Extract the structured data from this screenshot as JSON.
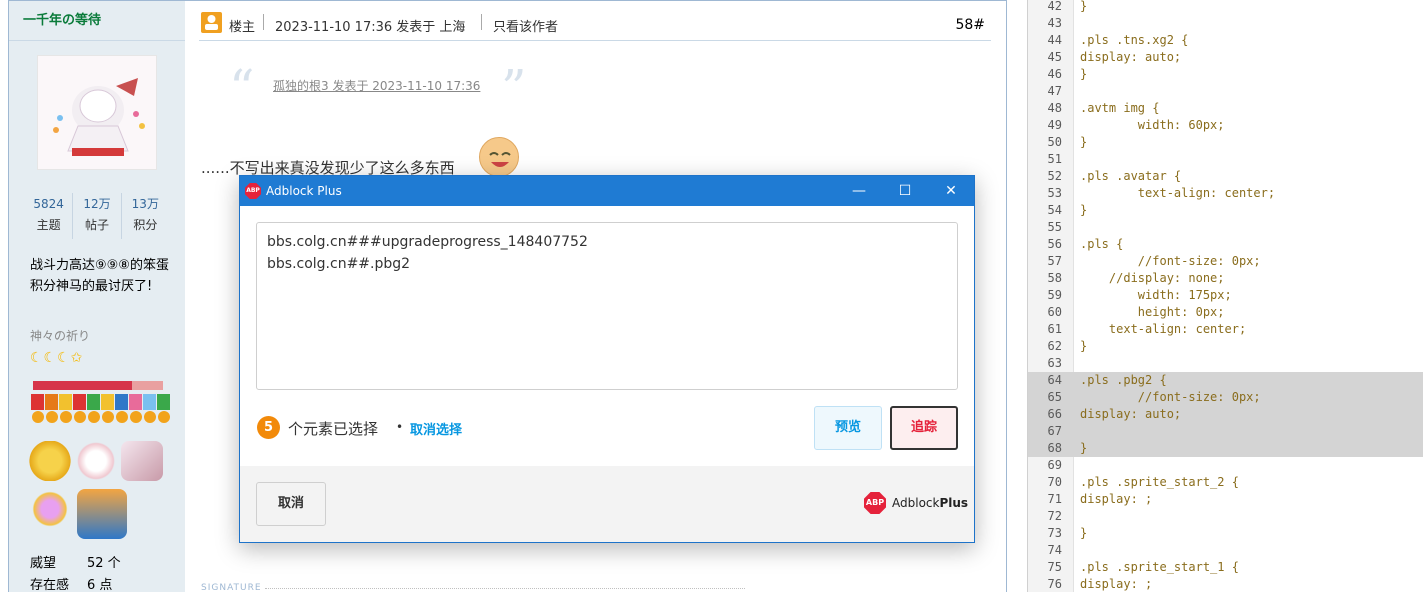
{
  "user": {
    "name": "一千年の等待",
    "stats": [
      {
        "value": "5824",
        "label": "主题"
      },
      {
        "value": "12万",
        "label": "帖子"
      },
      {
        "value": "13万",
        "label": "积分"
      }
    ],
    "title": "战斗力高达⑨⑨⑧的笨蛋积分神马的最讨厌了!",
    "group": "神々の祈り",
    "stars": "☾☾☾✩",
    "rank_progress": 0.76,
    "credits": [
      {
        "label": "威望",
        "value": "52 个"
      },
      {
        "label": "存在感",
        "value": "6 点"
      }
    ]
  },
  "post": {
    "owner_label": "楼主",
    "datetime": "2023-11-10 17:36 发表于 上海",
    "only_author": "只看该作者",
    "floor": "58#",
    "quote": "孤独的根3 发表于 2023-11-10 17:36",
    "content": "......不写出来真没发现少了这么多东西",
    "signature": "SIGNATURE"
  },
  "colors": {
    "titlebar": "#1f7bd3",
    "abp_red": "#e5223b",
    "accent_blue": "#0797e1",
    "badge_orange": "#f28a0a",
    "code_text": "#8a6d1d"
  },
  "dialog": {
    "title": "Adblock Plus",
    "logo_text": "ABP",
    "filters": [
      "bbs.colg.cn###upgradeprogress_148407752",
      "bbs.colg.cn##.pbg2"
    ],
    "selected_count": "5",
    "selected_text": "个元素已选择",
    "dot": "•",
    "deselect_label": "取消选择",
    "preview_label": "预览",
    "block_label": "追踪",
    "cancel_label": "取消",
    "brand_prefix": "Adblock",
    "brand_suffix": "Plus",
    "minimize_icon": "—",
    "maximize_icon": "☐",
    "close_icon": "✕"
  },
  "code": {
    "lines": [
      {
        "n": "42",
        "t": "}"
      },
      {
        "n": "43",
        "t": ""
      },
      {
        "n": "44",
        "t": ".pls .tns.xg2 {"
      },
      {
        "n": "45",
        "t": "display: auto;"
      },
      {
        "n": "46",
        "t": "}"
      },
      {
        "n": "47",
        "t": ""
      },
      {
        "n": "48",
        "t": ".avtm img {"
      },
      {
        "n": "49",
        "t": "        width: 60px;"
      },
      {
        "n": "50",
        "t": "}"
      },
      {
        "n": "51",
        "t": ""
      },
      {
        "n": "52",
        "t": ".pls .avatar {"
      },
      {
        "n": "53",
        "t": "        text-align: center;"
      },
      {
        "n": "54",
        "t": "}"
      },
      {
        "n": "55",
        "t": ""
      },
      {
        "n": "56",
        "t": ".pls {"
      },
      {
        "n": "57",
        "t": "        //font-size: 0px;"
      },
      {
        "n": "58",
        "t": "    //display: none;"
      },
      {
        "n": "59",
        "t": "        width: 175px;"
      },
      {
        "n": "60",
        "t": "        height: 0px;"
      },
      {
        "n": "61",
        "t": "    text-align: center;"
      },
      {
        "n": "62",
        "t": "}"
      },
      {
        "n": "63",
        "t": ""
      },
      {
        "n": "64",
        "t": ".pls .pbg2 {"
      },
      {
        "n": "65",
        "t": "        //font-size: 0px;"
      },
      {
        "n": "66",
        "t": "display: auto;"
      },
      {
        "n": "67",
        "t": ""
      },
      {
        "n": "68",
        "t": "}"
      },
      {
        "n": "69",
        "t": ""
      },
      {
        "n": "70",
        "t": ".pls .sprite_start_2 {"
      },
      {
        "n": "71",
        "t": "display: ;"
      },
      {
        "n": "72",
        "t": ""
      },
      {
        "n": "73",
        "t": "}"
      },
      {
        "n": "74",
        "t": ""
      },
      {
        "n": "75",
        "t": ".pls .sprite_start_1 {"
      },
      {
        "n": "76",
        "t": "display: ;"
      }
    ]
  }
}
